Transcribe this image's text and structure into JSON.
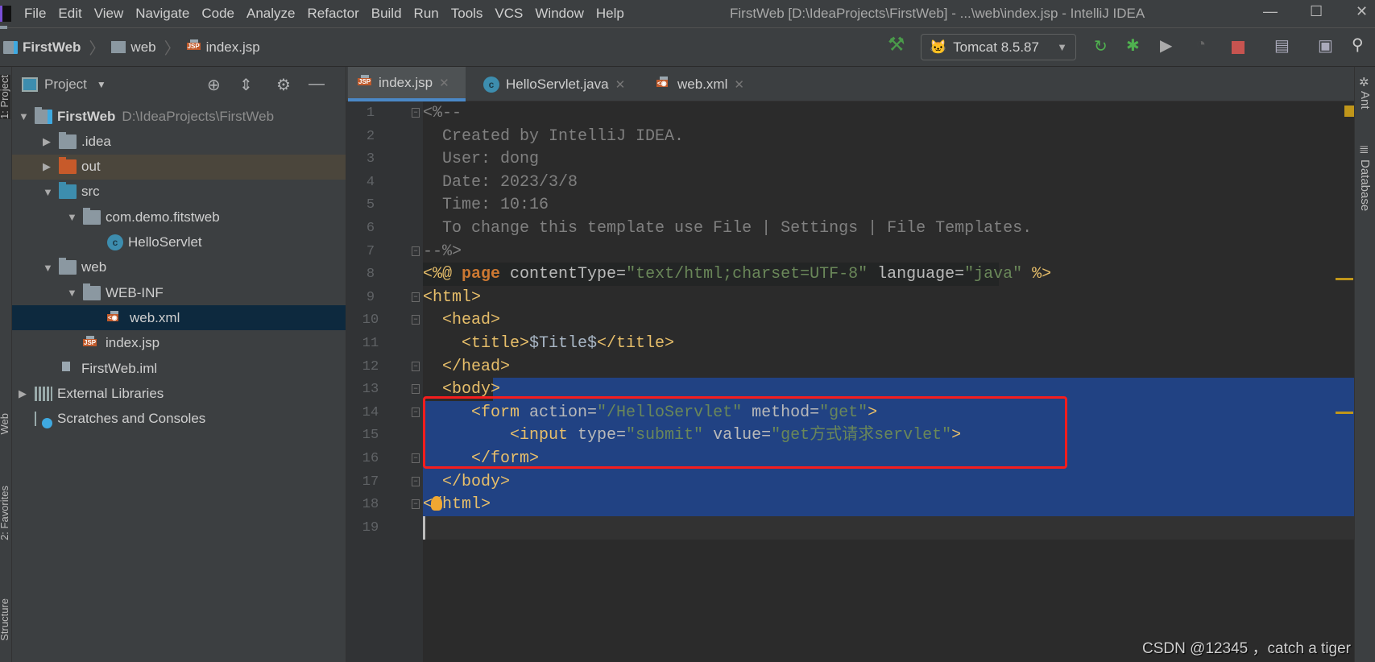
{
  "menubar": {
    "items": [
      "File",
      "Edit",
      "View",
      "Navigate",
      "Code",
      "Analyze",
      "Refactor",
      "Build",
      "Run",
      "Tools",
      "VCS",
      "Window",
      "Help"
    ],
    "title": "FirstWeb [D:\\IdeaProjects\\FirstWeb] - ...\\web\\index.jsp - IntelliJ IDEA"
  },
  "breadcrumb": [
    "FirstWeb",
    "web",
    "index.jsp"
  ],
  "toolbar": {
    "run_config": "Tomcat 8.5.87",
    "icons": [
      "build-hammer-icon",
      "rerun-icon",
      "debug-icon",
      "coverage-icon",
      "profile-icon",
      "stop-icon",
      "project-structure-icon",
      "terminal-icon",
      "search-icon"
    ]
  },
  "left_strip": [
    "1: Project",
    "Web",
    "2: Favorites",
    "Structure"
  ],
  "right_strip": [
    "Ant",
    "Database"
  ],
  "project": {
    "title": "Project",
    "tree": [
      {
        "label": "FirstWeb",
        "sub": "D:\\IdeaProjects\\FirstWeb",
        "level": 0,
        "arrow": "down",
        "icon": "module-folder-icon",
        "bold": true
      },
      {
        "label": ".idea",
        "level": 1,
        "arrow": "right",
        "icon": "folder-icon"
      },
      {
        "label": "out",
        "level": 1,
        "arrow": "right",
        "icon": "excluded-folder-icon",
        "highlight": "out"
      },
      {
        "label": "src",
        "level": 1,
        "arrow": "down",
        "icon": "source-folder-icon"
      },
      {
        "label": "com.demo.fitstweb",
        "level": 2,
        "arrow": "down",
        "icon": "package-icon"
      },
      {
        "label": "HelloServlet",
        "level": 3,
        "icon": "java-class-icon"
      },
      {
        "label": "web",
        "level": 1,
        "arrow": "down",
        "icon": "web-folder-icon"
      },
      {
        "label": "WEB-INF",
        "level": 2,
        "arrow": "down",
        "icon": "folder-icon"
      },
      {
        "label": "web.xml",
        "level": 3,
        "icon": "xml-file-icon",
        "highlight": "selected"
      },
      {
        "label": "index.jsp",
        "level": 2,
        "icon": "jsp-file-icon"
      },
      {
        "label": "FirstWeb.iml",
        "level": 1,
        "icon": "iml-file-icon"
      },
      {
        "label": "External Libraries",
        "level": 0,
        "arrow": "right",
        "icon": "libraries-icon"
      },
      {
        "label": "Scratches and Consoles",
        "level": 0,
        "icon": "scratches-icon"
      }
    ]
  },
  "tabs": [
    {
      "label": "index.jsp",
      "active": true,
      "icon": "jsp-file-icon"
    },
    {
      "label": "HelloServlet.java",
      "icon": "java-class-icon"
    },
    {
      "label": "web.xml",
      "icon": "xml-file-icon"
    }
  ],
  "code": [
    [
      [
        "comment",
        "<%--"
      ]
    ],
    [
      [
        "comment",
        "  Created by IntelliJ IDEA."
      ]
    ],
    [
      [
        "comment",
        "  User: dong"
      ]
    ],
    [
      [
        "comment",
        "  Date: 2023/3/8"
      ]
    ],
    [
      [
        "comment",
        "  Time: 10:16"
      ]
    ],
    [
      [
        "comment",
        "  To change this template use File | Settings | File Templates."
      ]
    ],
    [
      [
        "comment",
        "--%>"
      ]
    ],
    [
      [
        "tag",
        "<%@ "
      ],
      [
        "kw",
        "page "
      ],
      [
        "attr",
        "contentType="
      ],
      [
        "str",
        "\"text/html;charset=UTF-8\""
      ],
      [
        "attr",
        " language="
      ],
      [
        "str",
        "\"java\""
      ],
      [
        "tag",
        " %>"
      ]
    ],
    [
      [
        "tag",
        "<html>"
      ]
    ],
    [
      [
        "tag",
        "  <head>"
      ]
    ],
    [
      [
        "tag",
        "    <title>"
      ],
      [
        "plain",
        "$Title$"
      ],
      [
        "tag",
        "</title>"
      ]
    ],
    [
      [
        "tag",
        "  </head>"
      ]
    ],
    [
      [
        "tag",
        "  <body>"
      ]
    ],
    [
      [
        "tag",
        "     <form "
      ],
      [
        "attr",
        "action="
      ],
      [
        "str",
        "\"/HelloServlet\""
      ],
      [
        "attr",
        " method="
      ],
      [
        "str",
        "\"get\""
      ],
      [
        "tag",
        ">"
      ]
    ],
    [
      [
        "tag",
        "         <input "
      ],
      [
        "attr",
        "type="
      ],
      [
        "str",
        "\"submit\""
      ],
      [
        "attr",
        " value="
      ],
      [
        "str",
        "\"get方式请求servlet\""
      ],
      [
        "tag",
        ">"
      ]
    ],
    [
      [
        "tag",
        "     </form>"
      ]
    ],
    [
      [
        "tag",
        "  </body>"
      ]
    ],
    [
      [
        "tag",
        "</html>"
      ]
    ],
    [
      [
        "plain",
        ""
      ]
    ]
  ],
  "colors": {
    "selection": "#214283",
    "tag": "#e8bf6a",
    "string": "#6a8759",
    "comment": "#808080",
    "keyword": "#cc7832",
    "highlight_box": "#f51d1d"
  },
  "watermark": "CSDN @12345 ，catch a tiger"
}
